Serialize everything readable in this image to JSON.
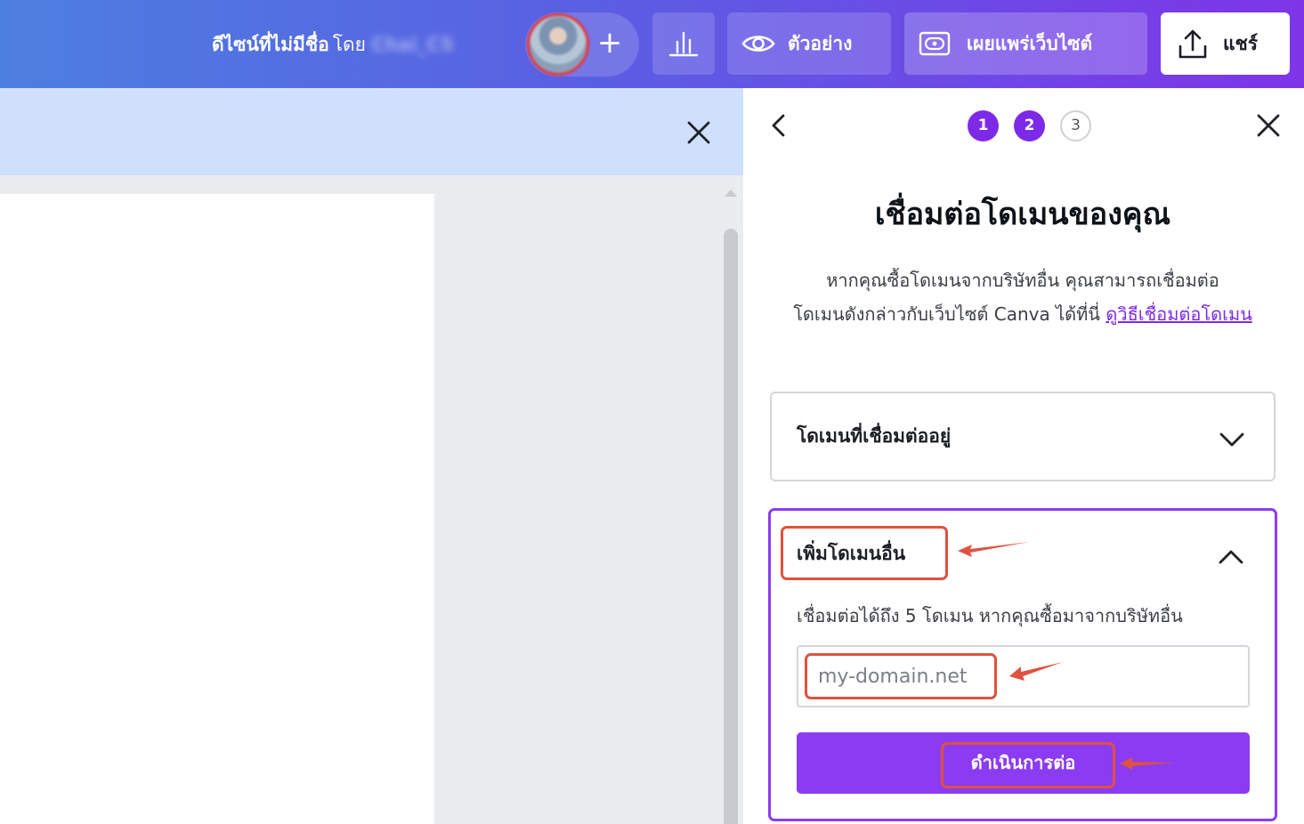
{
  "header": {
    "design_title": "ดีไซน์ที่ไม่มีชื่อ",
    "by_label": "โดย",
    "owner_name": "Chai_CS",
    "add_collaborator_icon": "plus-icon",
    "buttons": {
      "stats_icon": "bar-chart-icon",
      "preview_label": "ตัวอย่าง",
      "publish_label": "เผยแพร่เว็บไซต์",
      "share_label": "แชร์"
    },
    "colors": {
      "gradient_start": "#4d7fe0",
      "gradient_end": "#7e35e8"
    }
  },
  "banner": {
    "close_icon": "close-icon",
    "background": "#cfe0fd"
  },
  "panel": {
    "steps": [
      {
        "number": "1",
        "state": "done"
      },
      {
        "number": "2",
        "state": "current"
      },
      {
        "number": "3",
        "state": "todo"
      }
    ],
    "title": "เชื่อมต่อโดเมนของคุณ",
    "description_line1": "หากคุณซื้อโดเมนจากบริษัทอื่น คุณสามารถเชื่อมต่อ",
    "description_line2": "โดเมนดังกล่าวกับเว็บไซต์ Canva ได้ที่นี่",
    "description_link": "ดูวิธีเชื่อมต่อโดเมน",
    "connected_section_label": "โดเมนที่เชื่อมต่ออยู่",
    "add_section": {
      "label": "เพิ่มโดเมนอื่น",
      "help_text": "เชื่อมต่อได้ถึง 5 โดเมน หากคุณซื้อมาจากบริษัทอื่น",
      "input_value": "",
      "input_placeholder": "my-domain.net",
      "continue_label": "ดำเนินการต่อ"
    },
    "accent_color": "#8b3cf2"
  },
  "annotations": {
    "color": "#e0513f"
  }
}
